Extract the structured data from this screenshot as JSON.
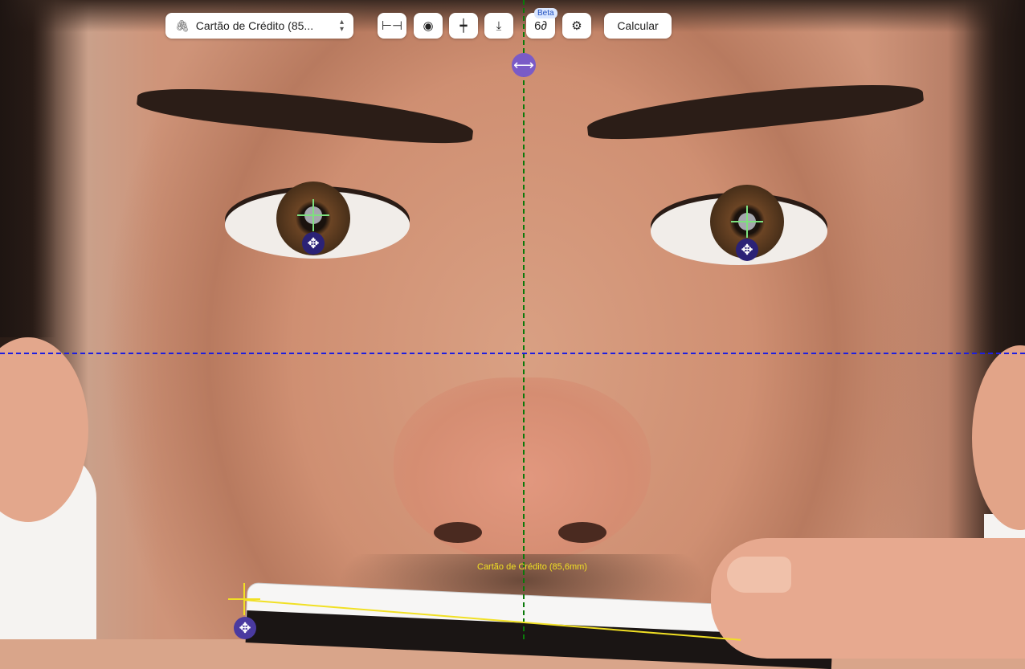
{
  "toolbar": {
    "reference_select": {
      "value": "Cartão de Crédito (85...",
      "icon": "paperclip-icon",
      "chevron": "up-down-chevron-icon"
    },
    "buttons": [
      {
        "name": "measure-width-button",
        "icon": "width-bracket-icon",
        "glyph": "⊢⊣"
      },
      {
        "name": "toggle-visibility-button",
        "icon": "eye-icon",
        "glyph": "◉"
      },
      {
        "name": "align-button",
        "icon": "horizontal-line-icon",
        "glyph": "┿"
      },
      {
        "name": "download-button",
        "icon": "download-icon",
        "glyph": "⤓"
      },
      {
        "name": "glasses-button",
        "icon": "glasses-icon",
        "glyph": "6∂",
        "badge": "Beta"
      },
      {
        "name": "settings-button",
        "icon": "sliders-icon",
        "glyph": "⚙"
      }
    ],
    "calculate_label": "Calcular"
  },
  "overlay": {
    "card_label": "Cartão de Crédito (85,6mm)",
    "handle_glyph": "✥",
    "center_handle_glyph": "⟷"
  },
  "colors": {
    "vertical_guide": "#0a7a0a",
    "horizontal_guide": "#1d1ee0",
    "pupil_crosshair": "#7ee07e",
    "card_marker": "#f1e024",
    "move_handle": "#2b2276",
    "center_handle": "#7a5bc7"
  }
}
